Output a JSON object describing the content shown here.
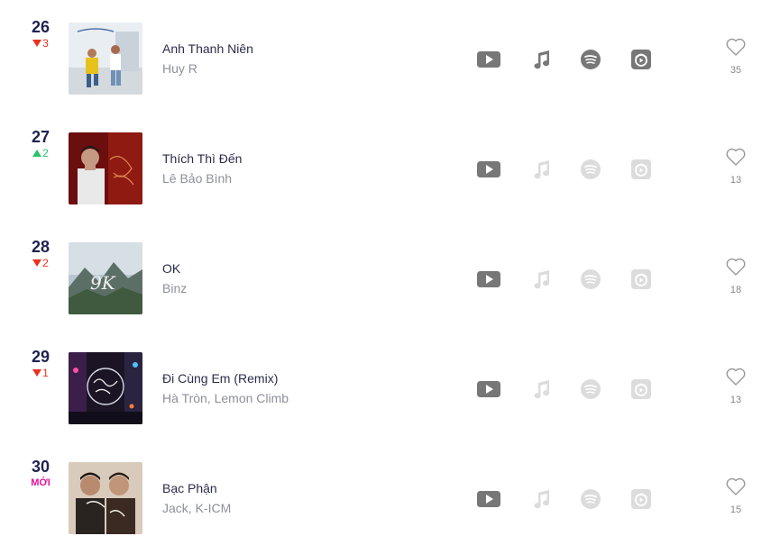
{
  "colors": {
    "rank_number": "#1f2250",
    "rank_down": "#e8321e",
    "rank_up": "#2bc26b",
    "rank_new": "#e5139b",
    "icon_active": "#777777",
    "icon_inactive": "#dcdcdc"
  },
  "songs": [
    {
      "rank": "26",
      "change": "3",
      "change_dir": "down",
      "title": "Anh Thanh Niên",
      "artist": "Huy R",
      "likes": "35",
      "platforms_all_active": true
    },
    {
      "rank": "27",
      "change": "2",
      "change_dir": "up",
      "title": "Thích Thì Đến",
      "artist": "Lê Bảo Bình",
      "likes": "13",
      "platforms_all_active": false
    },
    {
      "rank": "28",
      "change": "2",
      "change_dir": "down",
      "title": "OK",
      "artist": "Binz",
      "likes": "18",
      "platforms_all_active": false
    },
    {
      "rank": "29",
      "change": "1",
      "change_dir": "down",
      "title": "Đi Cùng Em (Remix)",
      "artist": "Hà Tròn, Lemon Climb",
      "likes": "13",
      "platforms_all_active": false
    },
    {
      "rank": "30",
      "change": "MỚI",
      "change_dir": "new",
      "title": "Bạc Phận",
      "artist": "Jack, K-ICM",
      "likes": "15",
      "platforms_all_active": false
    }
  ],
  "icons": [
    "youtube-icon",
    "music-note-icon",
    "spotify-icon",
    "nhaccuatui-icon",
    "heart-icon"
  ]
}
